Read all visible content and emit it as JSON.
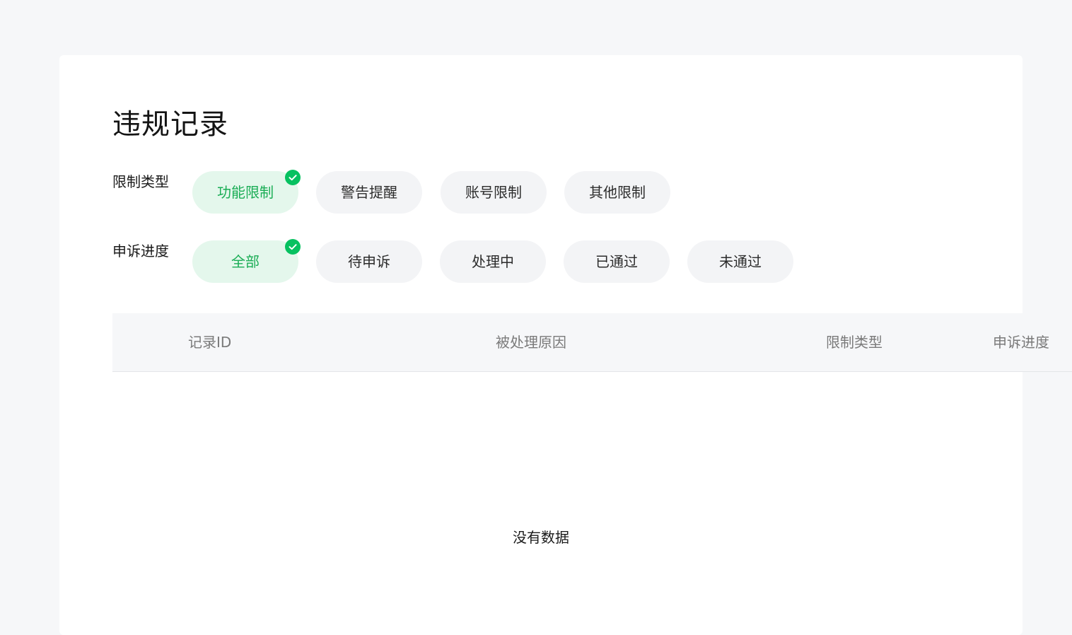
{
  "page": {
    "title": "违规记录"
  },
  "filters": {
    "restriction_type": {
      "label": "限制类型",
      "options": [
        "功能限制",
        "警告提醒",
        "账号限制",
        "其他限制"
      ],
      "selected": "功能限制"
    },
    "appeal_progress": {
      "label": "申诉进度",
      "options": [
        "全部",
        "待申诉",
        "处理中",
        "已通过",
        "未通过"
      ],
      "selected": "全部"
    }
  },
  "table": {
    "columns": [
      "记录ID",
      "被处理原因",
      "限制类型",
      "申诉进度"
    ],
    "rows": [],
    "empty_text": "没有数据"
  },
  "colors": {
    "accent": "#07c160",
    "selected_chip_bg": "#e4f7ec",
    "selected_chip_text": "#1aad55",
    "chip_bg": "#f3f4f6",
    "page_bg": "#f6f7f9"
  },
  "icons": {
    "selected_indicator": "check-circle-icon"
  }
}
